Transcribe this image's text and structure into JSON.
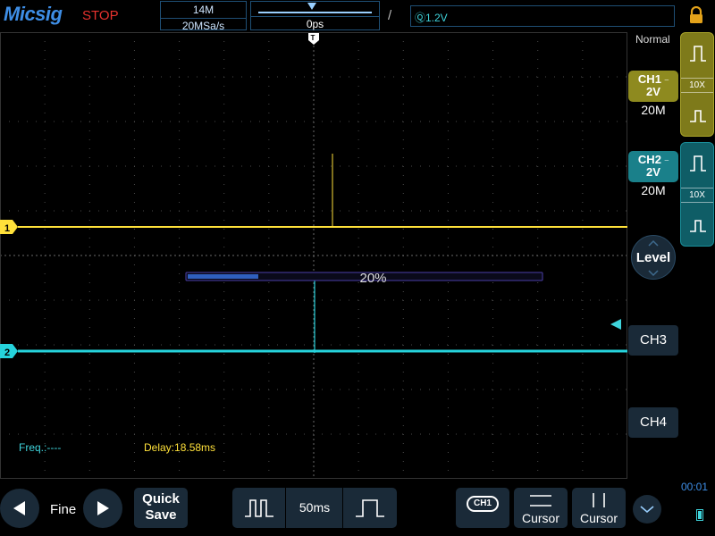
{
  "header": {
    "brand": "Micsig",
    "run_state": "STOP",
    "memory_depth": "14M",
    "sample_rate": "20MSa/s",
    "horizontal_position": "0ps",
    "trigger_edge_glyph": "/",
    "trigger_level": "Ⓠ1.2V",
    "lock_icon": "lock-icon"
  },
  "plot": {
    "ch1_marker": "1",
    "ch2_marker": "2",
    "trigger_marker": "T",
    "progress_text": "20%",
    "progress_value": 0.2,
    "freq_readout": "Freq.:----",
    "delay_readout": "Delay:18.58ms",
    "colors": {
      "ch1": "#ffe13a",
      "ch2": "#26d3dc",
      "grid": "#4a4a4a",
      "progress": "#2f5fbf"
    }
  },
  "right_panel": {
    "acq_mode": "Normal",
    "ch1": {
      "name": "CH1",
      "scale": "2V",
      "bandwidth": "20M",
      "probe": "10X"
    },
    "ch2": {
      "name": "CH2",
      "scale": "2V",
      "bandwidth": "20M",
      "probe": "10X"
    },
    "level_label": "Level",
    "ch3_label": "CH3",
    "ch4_label": "CH4"
  },
  "bottom_bar": {
    "fine_label": "Fine",
    "quick_save_line1": "Quick",
    "quick_save_line2": "Save",
    "timebase": "50ms",
    "ch_select": "CH1",
    "cursor_h_label": "Cursor",
    "cursor_v_label": "Cursor",
    "clock": "00:01"
  }
}
